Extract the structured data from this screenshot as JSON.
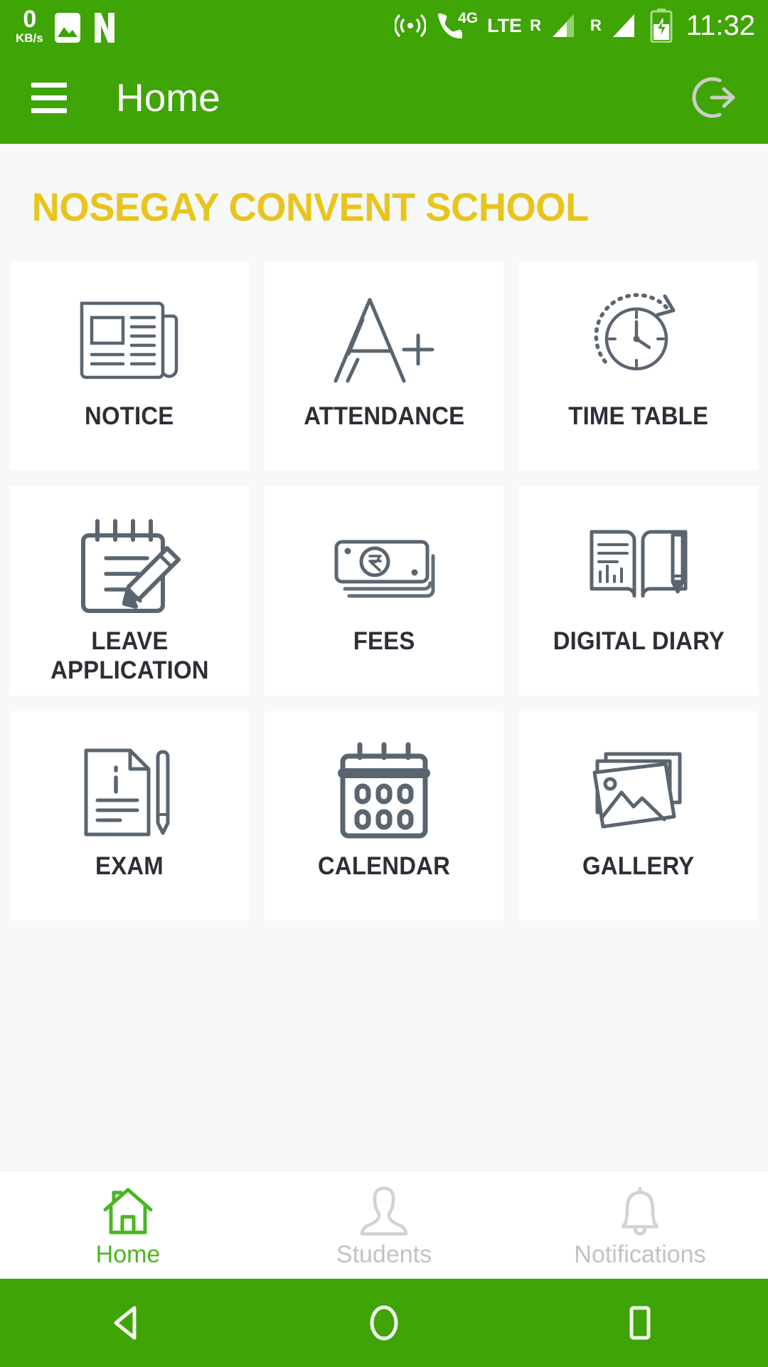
{
  "status_bar": {
    "net_speed_value": "0",
    "net_speed_unit": "KB/s",
    "icons": [
      "gallery-icon",
      "netflix-n-icon",
      "hotspot-icon",
      "call-4g-icon"
    ],
    "network_4g": "4G",
    "network_lte": "LTE",
    "sim1_roaming": "R",
    "sim2_roaming": "R",
    "time": "11:32"
  },
  "app_bar": {
    "menu_icon": "hamburger-menu-icon",
    "title": "Home",
    "logout_icon": "logout-icon"
  },
  "header": {
    "school_name": "NOSEGAY CONVENT SCHOOL",
    "school_name_color": "#e8c41d"
  },
  "grid": {
    "tiles": [
      {
        "label": "NOTICE",
        "icon": "newspaper-icon"
      },
      {
        "label": "ATTENDANCE",
        "icon": "a-plus-grade-icon"
      },
      {
        "label": "TIME TABLE",
        "icon": "clock-icon"
      },
      {
        "label": "LEAVE\nAPPLICATION",
        "icon": "notepad-pencil-icon"
      },
      {
        "label": "FEES",
        "icon": "banknotes-rupee-icon"
      },
      {
        "label": "DIGITAL DIARY",
        "icon": "open-book-pencil-icon"
      },
      {
        "label": "EXAM",
        "icon": "exam-paper-pen-icon"
      },
      {
        "label": "CALENDAR",
        "icon": "calendar-icon"
      },
      {
        "label": "GALLERY",
        "icon": "photos-stack-icon"
      }
    ]
  },
  "bottom_tabs": {
    "items": [
      {
        "label": "Home",
        "icon": "home-icon",
        "active": true
      },
      {
        "label": "Students",
        "icon": "person-icon",
        "active": false
      },
      {
        "label": "Notifications",
        "icon": "bell-icon",
        "active": false
      }
    ],
    "active_color": "#4cb522",
    "inactive_color": "#c2c2c2"
  },
  "android_nav": {
    "back": "back-triangle-icon",
    "home": "home-circle-icon",
    "recents": "recents-square-icon"
  },
  "theme": {
    "primary_green": "#3fa405",
    "icon_gray": "#5a6570",
    "background": "#f7f8f8"
  }
}
